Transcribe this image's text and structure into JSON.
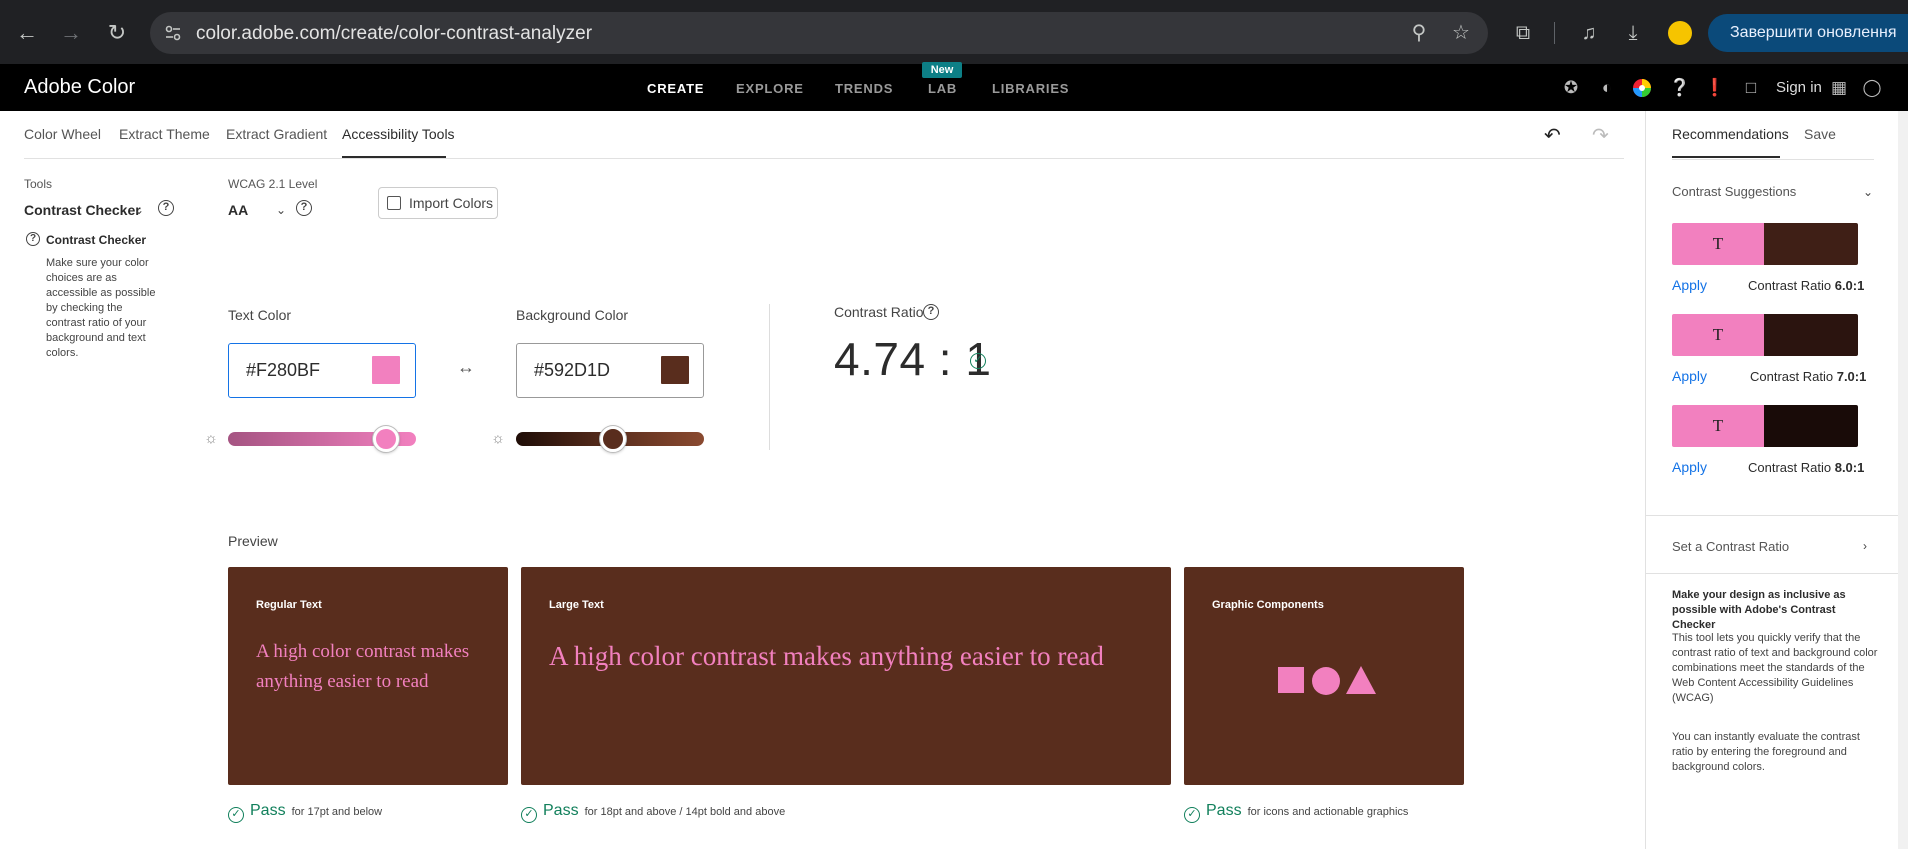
{
  "browser": {
    "url": "color.adobe.com/create/color-contrast-analyzer",
    "update_button": "Завершити оновлення"
  },
  "header": {
    "brand": "Adobe Color",
    "nav": [
      {
        "label": "CREATE",
        "active": true
      },
      {
        "label": "EXPLORE",
        "active": false
      },
      {
        "label": "TRENDS",
        "active": false
      },
      {
        "label": "LAB",
        "active": false
      },
      {
        "label": "LIBRARIES",
        "active": false
      }
    ],
    "new_badge": "New",
    "signin": "Sign in"
  },
  "tabs": [
    {
      "label": "Color Wheel",
      "active": false
    },
    {
      "label": "Extract Theme",
      "active": false
    },
    {
      "label": "Extract Gradient",
      "active": false
    },
    {
      "label": "Accessibility Tools",
      "active": true
    }
  ],
  "tools": {
    "label": "Tools",
    "selected": "Contrast Checker",
    "info_title": "Contrast Checker",
    "info_body": "Make sure your color choices are as accessible as possible by checking the contrast ratio of your background and text colors."
  },
  "wcag": {
    "label": "WCAG 2.1 Level",
    "selected": "AA"
  },
  "import_colors": "Import Colors",
  "text_color": {
    "label": "Text Color",
    "value": "#F280BF",
    "swatch": "#f280bf",
    "brightness": 0.91
  },
  "background_color": {
    "label": "Background Color",
    "value": "#592D1D",
    "swatch": "#592d1d",
    "brightness": 0.53
  },
  "contrast": {
    "label": "Contrast Ratio",
    "value": "4.74 : 1"
  },
  "preview": {
    "label": "Preview",
    "cards": [
      {
        "title": "Regular Text",
        "text": "A high color contrast makes anything easier to read"
      },
      {
        "title": "Large Text",
        "text": "A high color contrast makes anything easier to read"
      },
      {
        "title": "Graphic Components"
      }
    ],
    "results": [
      {
        "status": "Pass",
        "note": "for 17pt and below"
      },
      {
        "status": "Pass",
        "note": "for 18pt and above / 14pt bold and above"
      },
      {
        "status": "Pass",
        "note": "for icons and actionable graphics"
      }
    ]
  },
  "right_panel": {
    "tabs": [
      {
        "label": "Recommendations",
        "active": true
      },
      {
        "label": "Save",
        "active": false
      }
    ],
    "suggestions_heading": "Contrast Suggestions",
    "suggestions": [
      {
        "glyph": "T",
        "fg": "#f280bf",
        "bg": "#3f1f16",
        "apply": "Apply",
        "ratio_label": "Contrast Ratio",
        "ratio": "6.0:1"
      },
      {
        "glyph": "T",
        "fg": "#f280bf",
        "bg": "#2b140f",
        "apply": "Apply",
        "ratio_label": "Contrast Ratio",
        "ratio": "7.0:1"
      },
      {
        "glyph": "T",
        "fg": "#f280bf",
        "bg": "#190b08",
        "apply": "Apply",
        "ratio_label": "Contrast Ratio",
        "ratio": "8.0:1"
      }
    ],
    "set_ratio": "Set a Contrast Ratio",
    "info_title": "Make your design as inclusive as possible with Adobe's Contrast Checker",
    "info_p1": "This tool lets you quickly verify that the contrast ratio of text and background color combinations meet the standards of the Web Content Accessibility Guidelines (WCAG)",
    "info_p2": "You can instantly evaluate the contrast ratio by entering the foreground and background colors."
  }
}
